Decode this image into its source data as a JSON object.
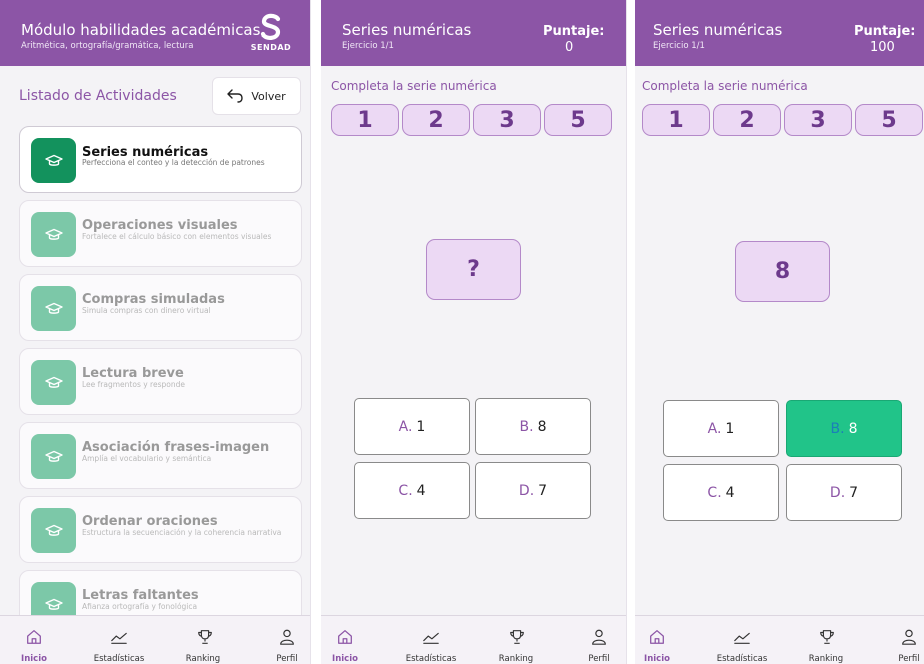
{
  "colors": {
    "accent": "#8c55a6",
    "green": "#13925d",
    "correct": "#21c489",
    "series_bg": "#ecd9f4"
  },
  "panel1": {
    "header": {
      "title": "Módulo habilidades académicas,",
      "subtitle": "Aritmética, ortografía/gramática, lectura",
      "logo_text": "SENDAD"
    },
    "list_title": "Listado de Actividades",
    "back_button": "Volver",
    "activities": [
      {
        "title": "Series numéricas",
        "desc": "Perfecciona el conteo y la detección de patrones",
        "icon": "graduation-cap-icon",
        "active": true
      },
      {
        "title": "Operaciones visuales",
        "desc": "Fortalece el cálculo básico con elementos visuales",
        "icon": "graduation-cap-icon",
        "active": false
      },
      {
        "title": "Compras simuladas",
        "desc": "Simula compras con dinero virtual",
        "icon": "graduation-cap-icon",
        "active": false
      },
      {
        "title": "Lectura breve",
        "desc": "Lee fragmentos y responde",
        "icon": "graduation-cap-icon",
        "active": false
      },
      {
        "title": "Asociación frases-imagen",
        "desc": "Amplía el vocabulario y semántica",
        "icon": "graduation-cap-icon",
        "active": false
      },
      {
        "title": "Ordenar oraciones",
        "desc": "Estructura la secuenciación y la coherencia narrativa",
        "icon": "graduation-cap-icon",
        "active": false
      },
      {
        "title": "Letras faltantes",
        "desc": "Afianza ortografía y fonológica",
        "icon": "graduation-cap-icon",
        "active": false
      }
    ]
  },
  "panel2": {
    "header": {
      "title": "Series numéricas",
      "subtitle": "Ejercicio 1/1",
      "score_label": "Puntaje:",
      "score": "0"
    },
    "instruction": "Completa la serie numérica",
    "series": [
      "1",
      "2",
      "3",
      "5"
    ],
    "answer": "?",
    "options": [
      {
        "letter": "A.",
        "value": "1",
        "correct": false
      },
      {
        "letter": "B.",
        "value": "8",
        "correct": false
      },
      {
        "letter": "C.",
        "value": "4",
        "correct": false
      },
      {
        "letter": "D.",
        "value": "7",
        "correct": false
      }
    ]
  },
  "panel3": {
    "header": {
      "title": "Series numéricas",
      "subtitle": "Ejercicio 1/1",
      "score_label": "Puntaje:",
      "score": "100"
    },
    "instruction": "Completa la serie numérica",
    "series": [
      "1",
      "2",
      "3",
      "5"
    ],
    "answer": "8",
    "options": [
      {
        "letter": "A.",
        "value": "1",
        "correct": false
      },
      {
        "letter": "B.",
        "value": "8",
        "correct": true
      },
      {
        "letter": "C.",
        "value": "4",
        "correct": false
      },
      {
        "letter": "D.",
        "value": "7",
        "correct": false
      }
    ]
  },
  "nav": [
    {
      "label": "Inicio",
      "icon": "home-icon",
      "active": true
    },
    {
      "label": "Estadísticas",
      "icon": "chart-line-icon",
      "active": false
    },
    {
      "label": "Ranking",
      "icon": "trophy-icon",
      "active": false
    },
    {
      "label": "Perfil",
      "icon": "user-icon",
      "active": false
    }
  ]
}
